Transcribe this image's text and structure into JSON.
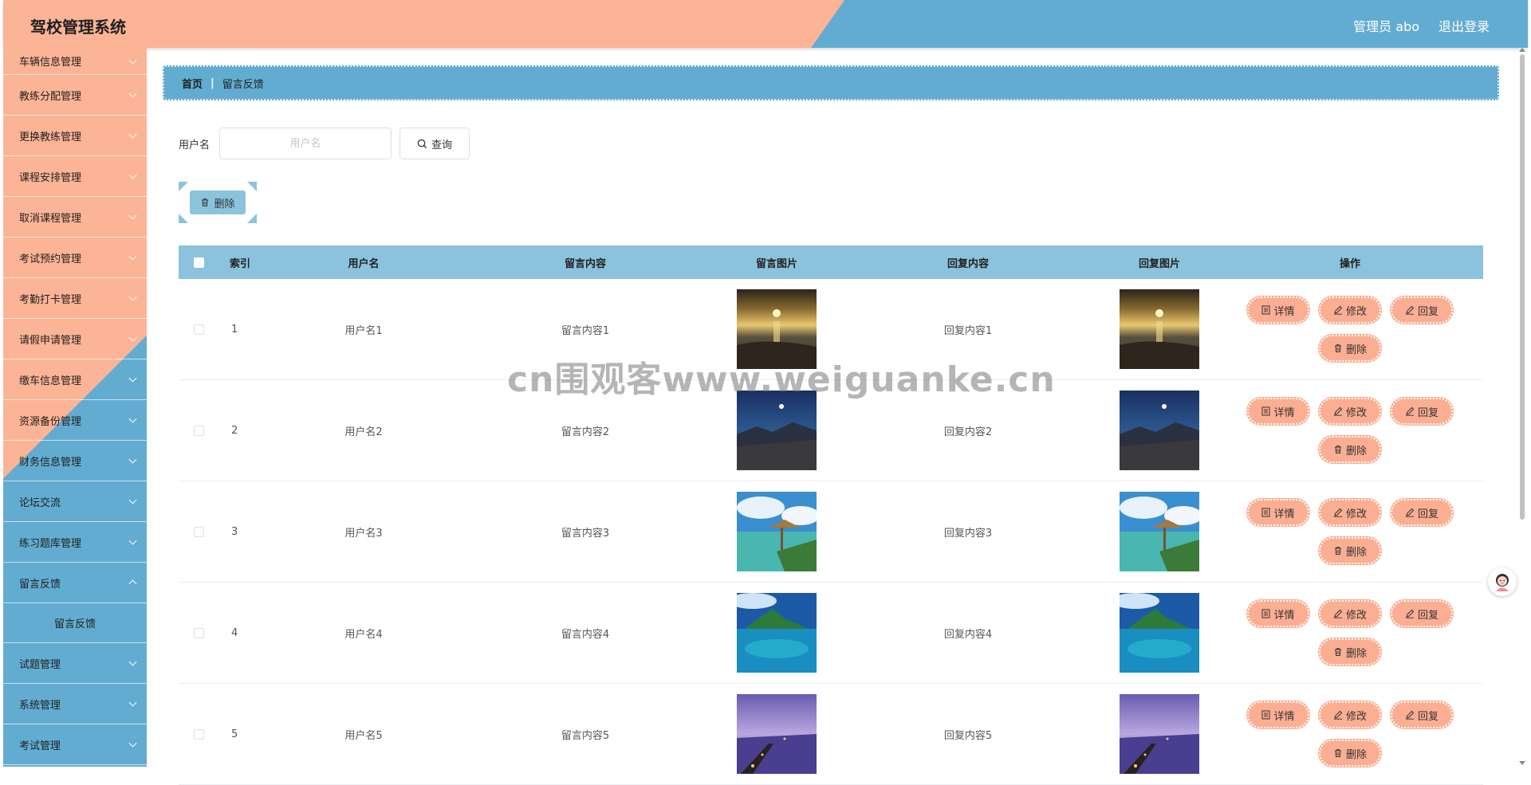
{
  "header": {
    "title": "驾校管理系统",
    "admin": "管理员 abo",
    "logout": "退出登录"
  },
  "sidebar": {
    "items": [
      {
        "label": "车辆信息管理"
      },
      {
        "label": "教练分配管理"
      },
      {
        "label": "更换教练管理"
      },
      {
        "label": "课程安排管理"
      },
      {
        "label": "取消课程管理"
      },
      {
        "label": "考试预约管理"
      },
      {
        "label": "考勤打卡管理"
      },
      {
        "label": "请假申请管理"
      },
      {
        "label": "缴车信息管理"
      },
      {
        "label": "资源备份管理"
      },
      {
        "label": "财务信息管理"
      },
      {
        "label": "论坛交流"
      },
      {
        "label": "练习题库管理"
      },
      {
        "label": "留言反馈"
      }
    ],
    "submenu_label": "留言反馈",
    "items_after": [
      {
        "label": "试题管理"
      },
      {
        "label": "系统管理"
      },
      {
        "label": "考试管理"
      }
    ]
  },
  "breadcrumb": {
    "home": "首页",
    "separator": "|",
    "current": "留言反馈"
  },
  "search": {
    "label": "用户名",
    "placeholder": "用户名",
    "value": "",
    "button": "查询"
  },
  "toolbar": {
    "delete_label": "删除"
  },
  "table": {
    "headers": {
      "index": "索引",
      "username": "用户名",
      "message": "留言内容",
      "message_image": "留言图片",
      "reply": "回复内容",
      "reply_image": "回复图片",
      "actions": "操作"
    },
    "rows": [
      {
        "index": "1",
        "username": "用户名1",
        "message": "留言内容1",
        "reply": "回复内容1",
        "image": "sunset-beach"
      },
      {
        "index": "2",
        "username": "用户名2",
        "message": "留言内容2",
        "reply": "回复内容2",
        "image": "night-town"
      },
      {
        "index": "3",
        "username": "用户名3",
        "message": "留言内容3",
        "reply": "回复内容3",
        "image": "tropical-hut"
      },
      {
        "index": "4",
        "username": "用户名4",
        "message": "留言内容4",
        "reply": "回复内容4",
        "image": "island-lagoon"
      },
      {
        "index": "5",
        "username": "用户名5",
        "message": "留言内容5",
        "reply": "回复内容5",
        "image": "purple-pier"
      }
    ],
    "actions": {
      "detail": "详情",
      "edit": "修改",
      "reply": "回复",
      "delete": "删除"
    }
  },
  "watermark": "cn围观客www.weiguanke.cn",
  "colors": {
    "peach": "#fcb496",
    "blue": "#63acd1",
    "table_header": "#8bc3dd",
    "action_button": "#fbae92"
  }
}
